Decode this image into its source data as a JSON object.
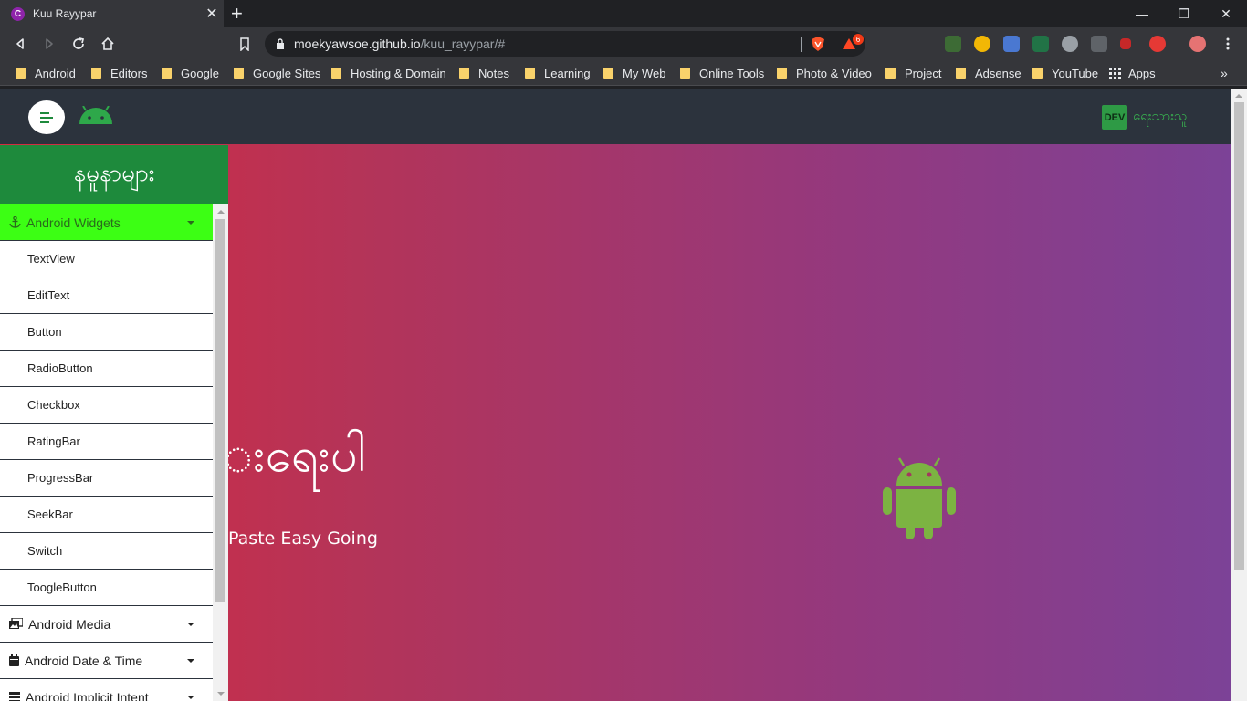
{
  "browser": {
    "tab_title": "Kuu Rayypar",
    "tab_favicon_letter": "C",
    "url_host": "moekyawsoe.github.io",
    "url_path": "/kuu_rayypar/#",
    "brave_badge_count": "6"
  },
  "bookmarks": [
    {
      "label": "Android"
    },
    {
      "label": "Editors"
    },
    {
      "label": "Google"
    },
    {
      "label": "Google Sites"
    },
    {
      "label": "Hosting & Domain"
    },
    {
      "label": "Notes"
    },
    {
      "label": "Learning"
    },
    {
      "label": "My Web"
    },
    {
      "label": "Online Tools"
    },
    {
      "label": "Photo & Video"
    },
    {
      "label": "Project"
    },
    {
      "label": "Adsense"
    },
    {
      "label": "YouTube"
    }
  ],
  "bookmarks_apps_label": "Apps",
  "navbar": {
    "dev_badge": "DEV",
    "dev_text": "ရေးသားသူ"
  },
  "sidebar": {
    "heading": "နမူနာများ",
    "groups": [
      {
        "label": "Android Widgets",
        "icon": "anchor-icon",
        "expanded": true,
        "items": [
          "TextView",
          "EditText",
          "Button",
          "RadioButton",
          "Checkbox",
          "RatingBar",
          "ProgressBar",
          "SeekBar",
          "Switch",
          "ToogleButton"
        ]
      },
      {
        "label": "Android Media",
        "icon": "photo-video-icon",
        "expanded": false
      },
      {
        "label": "Android Date & Time",
        "icon": "calendar-icon",
        "expanded": false
      },
      {
        "label": "Android Implicit Intent",
        "icon": "list-icon",
        "expanded": false
      }
    ]
  },
  "hero": {
    "title": "းရေးပါ",
    "subtitle": "k Paste Easy Going"
  },
  "colors": {
    "navbar": "#2c333d",
    "sidebar_header": "#1e8a3c",
    "active_group": "#3cff14",
    "android_green": "#7cb342",
    "gradient_left": "#d62a40",
    "gradient_right": "#7c4297"
  }
}
